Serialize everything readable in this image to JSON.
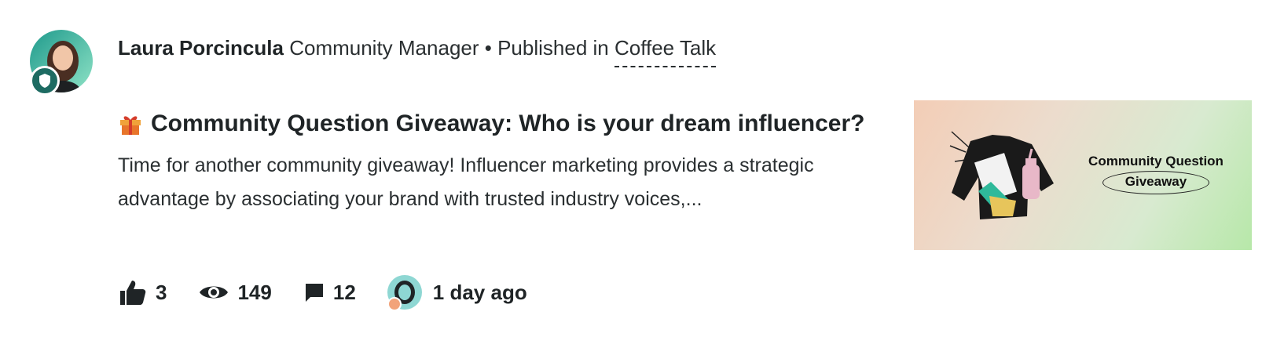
{
  "post": {
    "author": "Laura Porcincula",
    "role": "Community Manager",
    "separator": "•",
    "published_in_label": "Published in",
    "space": "Coffee Talk",
    "title": "Community Question Giveaway: Who is your dream influencer?",
    "title_icon": "gift-icon",
    "excerpt": "Time for another community giveaway! Influencer marketing provides a strategic advantage by associating your brand with trusted industry voices,...",
    "thumbnail": {
      "line1": "Community Question",
      "line2": "Giveaway"
    }
  },
  "stats": {
    "likes": "3",
    "views": "149",
    "comments": "12",
    "last_activity": "1 day ago"
  },
  "icons": {
    "likes": "thumbs-up-icon",
    "views": "eye-icon",
    "comments": "comment-icon",
    "moderator": "shield-icon"
  },
  "colors": {
    "text": "#1f2426",
    "badge": "#1d6b62",
    "avatar_bg": "#8ed7d3",
    "thumb_gradient_start": "#f3cdb6",
    "thumb_gradient_end": "#b7e8a9"
  }
}
